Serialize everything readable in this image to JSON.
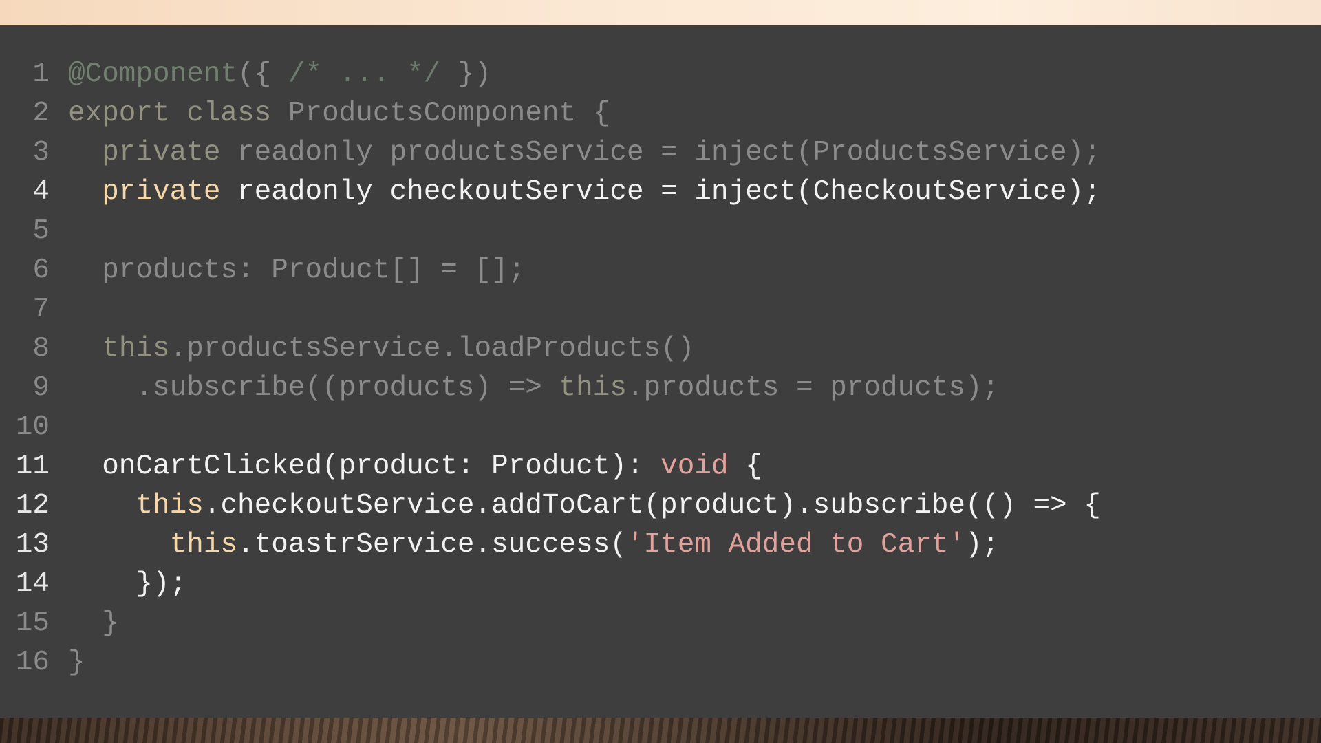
{
  "lines": [
    {
      "n": "1",
      "state": "dim",
      "parts": [
        [
          "dec",
          "@Component"
        ],
        [
          "p",
          "({ "
        ],
        [
          "cm",
          "/* ... */"
        ],
        [
          "p",
          " })"
        ]
      ]
    },
    {
      "n": "2",
      "state": "dim",
      "parts": [
        [
          "kw",
          "export class "
        ],
        [
          "p",
          "ProductsComponent {"
        ]
      ]
    },
    {
      "n": "3",
      "state": "dim",
      "parts": [
        [
          "p",
          "  "
        ],
        [
          "kw",
          "private"
        ],
        [
          "p",
          " readonly productsService = inject(ProductsService);"
        ]
      ]
    },
    {
      "n": "4",
      "state": "bright",
      "parts": [
        [
          "p",
          "  "
        ],
        [
          "kw",
          "private"
        ],
        [
          "p",
          " readonly checkoutService = inject(CheckoutService);"
        ]
      ]
    },
    {
      "n": "5",
      "state": "dim",
      "parts": []
    },
    {
      "n": "6",
      "state": "dim",
      "parts": [
        [
          "p",
          "  products: Product[] = [];"
        ]
      ]
    },
    {
      "n": "7",
      "state": "dim",
      "parts": []
    },
    {
      "n": "8",
      "state": "dim",
      "parts": [
        [
          "p",
          "  "
        ],
        [
          "kw",
          "this"
        ],
        [
          "p",
          ".productsService.loadProducts()"
        ]
      ]
    },
    {
      "n": "9",
      "state": "dim",
      "parts": [
        [
          "p",
          "    .subscribe((products) => "
        ],
        [
          "kw",
          "this"
        ],
        [
          "p",
          ".products = products);"
        ]
      ]
    },
    {
      "n": "10",
      "state": "dim",
      "parts": []
    },
    {
      "n": "11",
      "state": "bright",
      "parts": [
        [
          "p",
          "  onCartClicked(product: Product): "
        ],
        [
          "void",
          "void"
        ],
        [
          "p",
          " {"
        ]
      ]
    },
    {
      "n": "12",
      "state": "bright",
      "parts": [
        [
          "p",
          "    "
        ],
        [
          "kw",
          "this"
        ],
        [
          "p",
          ".checkoutService.addToCart(product).subscribe(() => {"
        ]
      ]
    },
    {
      "n": "13",
      "state": "bright",
      "parts": [
        [
          "p",
          "      "
        ],
        [
          "kw",
          "this"
        ],
        [
          "p",
          ".toastrService.success("
        ],
        [
          "str",
          "'Item Added to Cart'"
        ],
        [
          "p",
          ");"
        ]
      ]
    },
    {
      "n": "14",
      "state": "bright",
      "parts": [
        [
          "p",
          "    });"
        ]
      ]
    },
    {
      "n": "15",
      "state": "dim",
      "parts": [
        [
          "p",
          "  }"
        ]
      ]
    },
    {
      "n": "16",
      "state": "dim",
      "parts": [
        [
          "p",
          "}"
        ]
      ]
    }
  ]
}
